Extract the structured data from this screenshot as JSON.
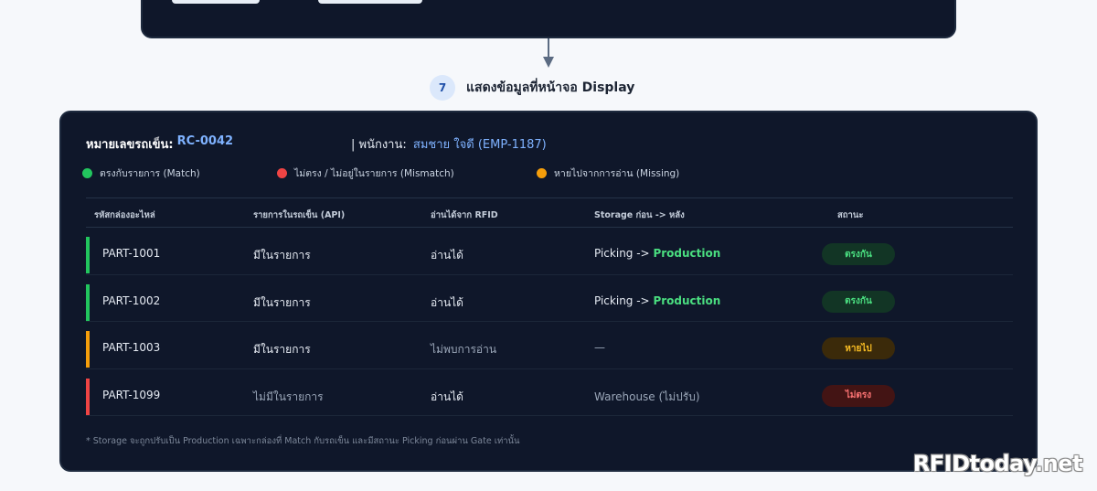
{
  "step": {
    "number": "7",
    "title": "แสดงข้อมูลที่หน้าจอ Display"
  },
  "header": {
    "truck_label": "หมายเลขรถเข็น:",
    "truck_id": "RC-0042",
    "employee_label": "| พนักงาน:",
    "employee_value": "สมชาย ใจดี (EMP-1187)"
  },
  "legend": [
    {
      "label": "ตรงกับรายการ (Match)",
      "color": "#22c55e"
    },
    {
      "label": "ไม่ตรง / ไม่อยู่ในรายการ (Mismatch)",
      "color": "#ef4444"
    },
    {
      "label": "หายไปจากการอ่าน (Missing)",
      "color": "#f59e0b"
    }
  ],
  "table": {
    "columns": [
      "รหัสกล่องอะไหล่",
      "รายการในรถเข็น (API)",
      "อ่านได้จาก RFID",
      "Storage ก่อน -> หลัง",
      "สถานะ"
    ],
    "rows": [
      {
        "part": "PART-1001",
        "api": "มีในรายการ",
        "rfid": "อ่านได้",
        "storage_prefix": "Picking -> ",
        "storage_target": "Production",
        "status": "ตรงกัน",
        "accent": "#22c55e"
      },
      {
        "part": "PART-1002",
        "api": "มีในรายการ",
        "rfid": "อ่านได้",
        "storage_prefix": "Picking -> ",
        "storage_target": "Production",
        "status": "ตรงกัน",
        "accent": "#22c55e"
      },
      {
        "part": "PART-1003",
        "api": "มีในรายการ",
        "rfid": "ไม่พบการอ่าน",
        "storage_prefix": "—",
        "storage_target": "",
        "status": "หายไป",
        "accent": "#f59e0b"
      },
      {
        "part": "PART-1099",
        "api": "ไม่มีในรายการ",
        "rfid": "อ่านได้",
        "storage_prefix": "Warehouse (ไม่ปรับ)",
        "storage_target": "",
        "status": "ไม่ตรง",
        "accent": "#ef4444"
      }
    ]
  },
  "footnote": "* Storage จะถูกปรับเป็น Production เฉพาะกล่องที่ Match กับรถเข็น และมีสถานะ Picking ก่อนผ่าน Gate เท่านั้น",
  "watermark": "RFIDtoday.net",
  "colors": {
    "match": "#22c55e",
    "mismatch": "#ef4444",
    "missing": "#f59e0b",
    "panel_bg": "#0f172a",
    "accent_text": "#7fb2ff"
  }
}
